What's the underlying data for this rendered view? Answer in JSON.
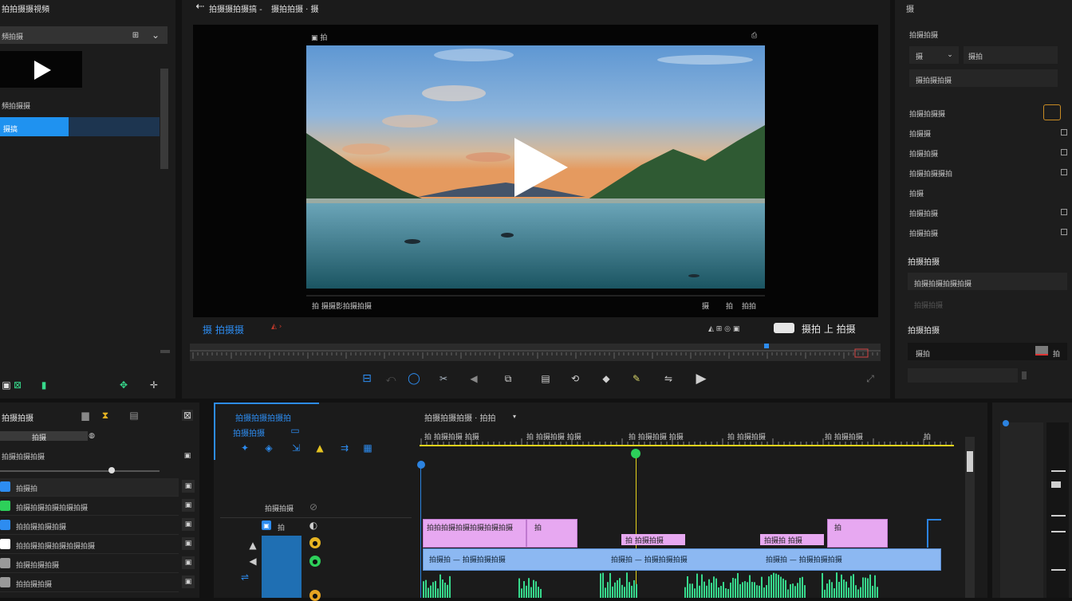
{
  "colors": {
    "accent_blue": "#2d8cf0",
    "playhead_yellow": "#e6d21c",
    "playhead_green": "#2dd05a",
    "clip_pink": "#e7a8f1",
    "clip_blue": "#8cb8f2",
    "waveform_green": "#37d98c",
    "cursor_blue": "#2c83e0"
  },
  "left_panel": {
    "title": "拍拍摄摄視頻",
    "search_row": "頻拍摄",
    "search_icons": [
      "⊞",
      "⌄"
    ],
    "list_label": "頻拍摄摄",
    "selected_item": "摄搞",
    "footer_icons": [
      "▣",
      "⊠",
      "▮",
      "✥",
      "✛"
    ]
  },
  "top_bar": {
    "back_arrow": "⇠",
    "project_title": "拍摄摄拍摄搞 -",
    "project_suffix": "摄拍拍摄 · 摄"
  },
  "viewer": {
    "overlay_left": "▣ 拍",
    "overlay_right": "⎙",
    "status_left": "拍 摄摄影拍摄拍摄",
    "status_right_1": "摄",
    "status_right_2": "拍",
    "status_right_3": "拍拍",
    "timecode_left": "摄 拍摄摄",
    "timecode_right": "摄拍 上 拍摄",
    "transport_icons": [
      "⊟",
      "⤺",
      "◯",
      "✂",
      "◀",
      "⧉",
      "▤",
      "⟲",
      "◆",
      "✎",
      "⇋",
      "▶"
    ],
    "expand_icon": "⤢"
  },
  "inspector": {
    "title": "摄",
    "section1": "拍摄拍摄",
    "dropdown1": "摄",
    "dropdown2": "摄拍",
    "field1": "摄拍摄拍摄",
    "rows": [
      "拍摄拍摄摄",
      "拍摄摄",
      "拍摄拍摄",
      "拍摄拍摄摄拍",
      "拍摄",
      "拍摄拍摄",
      "拍摄拍摄"
    ],
    "section2": "拍摄拍摄",
    "field2": "拍摄拍摄拍摄拍摄",
    "field2_sub": "拍摄拍摄",
    "section3": "拍摄拍摄",
    "value_row": "摄拍",
    "value_right": "拍"
  },
  "bottom_left": {
    "title": "拍摄拍摄",
    "slider_value": "拍摄",
    "subtitle": "拍摄拍摄拍摄",
    "tracks": [
      {
        "label": "拍摄拍",
        "color": "#2d8cf0"
      },
      {
        "label": "拍摄拍摄拍摄拍摄拍摄",
        "color": "#2dd05a"
      },
      {
        "label": "拍拍摄拍摄拍摄",
        "color": "#2d8cf0"
      },
      {
        "label": "拍拍摄拍摄拍摄拍摄拍摄",
        "color": "#ffffff"
      },
      {
        "label": "拍摄拍摄拍摄",
        "color": "#9a9a9a"
      },
      {
        "label": "拍拍摄拍摄",
        "color": "#9a9a9a"
      }
    ]
  },
  "timeline": {
    "tools_title": "拍摄拍摄拍摄拍",
    "tools_sub": "拍摄拍摄",
    "sequence_title": "拍摄拍摄拍摄 · 拍拍",
    "ruler_labels": [
      "拍 拍摄拍摄 拍摄",
      "拍 拍摄拍摄 拍摄",
      "拍 拍摄拍摄 拍摄",
      "拍 拍摄拍摄",
      "拍 拍摄拍摄",
      "拍"
    ],
    "track_header": "拍摄拍摄",
    "v1_label": "拍",
    "clip_title": "拍拍拍摄拍摄拍摄拍摄拍摄",
    "clip_small": "拍",
    "clip_row2": [
      "拍 拍摄拍摄",
      "拍摄拍 拍摄",
      "拍"
    ],
    "audio_label": "拍摄拍 — 拍摄拍摄拍摄"
  }
}
